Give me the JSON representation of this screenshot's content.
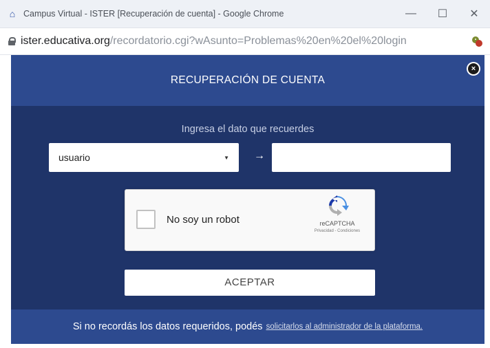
{
  "window": {
    "title": "Campus Virtual - ISTER [Recuperación de cuenta] - Google Chrome",
    "controls": {
      "minimize": "—",
      "maximize": "☐",
      "close": "✕"
    }
  },
  "address_bar": {
    "host": "ister.educativa.org",
    "path": "/recordatorio.cgi?wAsunto=Problemas%20en%20el%20login"
  },
  "modal": {
    "title": "RECUPERACIÓN DE CUENTA",
    "close_symbol": "×",
    "prompt": "Ingresa el dato que recuerdes",
    "field_select": {
      "selected": "usuario"
    },
    "arrow_symbol": "→",
    "value_input": {
      "value": ""
    },
    "recaptcha": {
      "label": "No soy un robot",
      "brand": "reCAPTCHA",
      "links": "Privacidad - Condiciones"
    },
    "accept_label": "ACEPTAR",
    "footer": {
      "text": "Si no recordás los datos requeridos, podés",
      "link": "solicitarlos al administrador de la plataforma."
    }
  },
  "colors": {
    "modal_bg": "#1f3469",
    "header_bg": "#2d4a8f",
    "footer_bg": "#2d4a8f"
  }
}
